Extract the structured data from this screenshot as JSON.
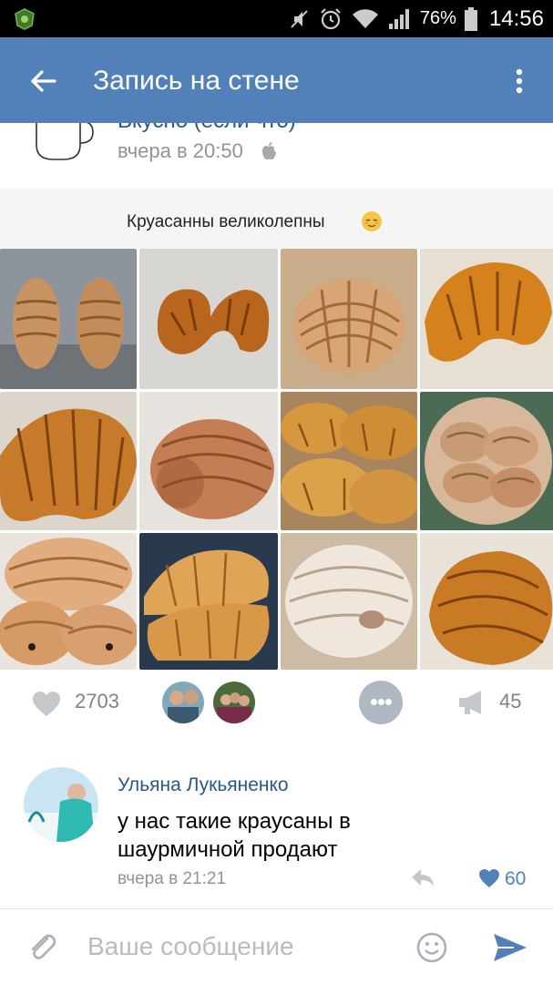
{
  "status_bar": {
    "battery": "76%",
    "time": "14:56"
  },
  "app_bar": {
    "title": "Запись на стене"
  },
  "post": {
    "author_clipped": "Вкусно (если что)",
    "time": "вчера в 20:50",
    "image_caption": "Круасанны великолепны",
    "grid": [
      "shar-pei",
      "croissant",
      "croissant",
      "croissant",
      "croissant",
      "shar-pei",
      "croissant",
      "shar-pei",
      "shar-pei",
      "croissant",
      "shar-pei",
      "croissant"
    ]
  },
  "actions": {
    "likes": "2703",
    "shares": "45"
  },
  "comment": {
    "author": "Ульяна Лукьяненко",
    "text": "у нас такие краусаны в шаурмичной продают",
    "time": "вчера в 21:21",
    "likes": "60"
  },
  "composer": {
    "placeholder": "Ваше сообщение"
  },
  "colors": {
    "app_bar": "#5181b8",
    "link": "#2a5885",
    "meta": "#939393",
    "muted": "#828282",
    "accent": "#5181b8"
  }
}
